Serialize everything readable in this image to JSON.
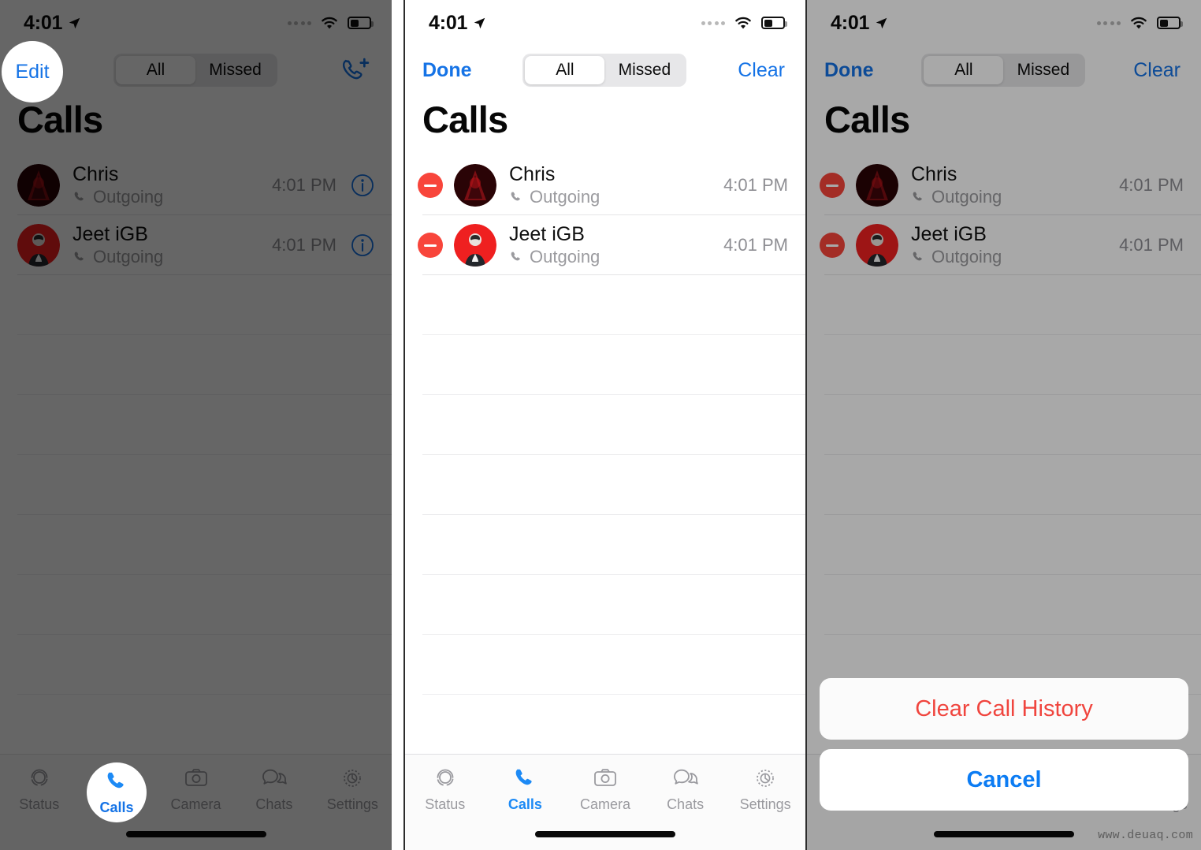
{
  "status_bar": {
    "time": "4:01",
    "location_icon": "location-arrow-icon",
    "signal_icon": "signal-dots-icon",
    "wifi_icon": "wifi-icon",
    "battery_icon": "battery-icon"
  },
  "page_title": "Calls",
  "nav": {
    "edit_label": "Edit",
    "done_label": "Done",
    "clear_label": "Clear",
    "add_call_icon": "phone-plus-icon",
    "segments": [
      {
        "label": "All",
        "selected": true
      },
      {
        "label": "Missed",
        "selected": false
      }
    ]
  },
  "calls": [
    {
      "name": "Chris",
      "direction": "Outgoing",
      "time": "4:01 PM",
      "direction_icon": "phone-icon",
      "info_icon": "info-circle-icon",
      "delete_icon": "minus-circle-icon",
      "avatar": "avatar-chris"
    },
    {
      "name": "Jeet iGB",
      "direction": "Outgoing",
      "time": "4:01 PM",
      "direction_icon": "phone-icon",
      "info_icon": "info-circle-icon",
      "delete_icon": "minus-circle-icon",
      "avatar": "avatar-jeet"
    }
  ],
  "tabs": [
    {
      "label": "Status",
      "icon": "status-rings-icon",
      "active": false
    },
    {
      "label": "Calls",
      "icon": "phone-icon",
      "active": true
    },
    {
      "label": "Camera",
      "icon": "camera-icon",
      "active": false
    },
    {
      "label": "Chats",
      "icon": "chat-bubbles-icon",
      "active": false
    },
    {
      "label": "Settings",
      "icon": "gear-icon",
      "active": false
    }
  ],
  "action_sheet": {
    "clear_label": "Clear Call History",
    "cancel_label": "Cancel"
  },
  "watermark": "www.deuaq.com",
  "colors": {
    "accent_blue": "#1573e6",
    "destructive_red": "#f0453e",
    "delete_red": "#f8453b",
    "tab_inactive": "#9a9a9f",
    "subtitle_gray": "#9b9b9f"
  }
}
